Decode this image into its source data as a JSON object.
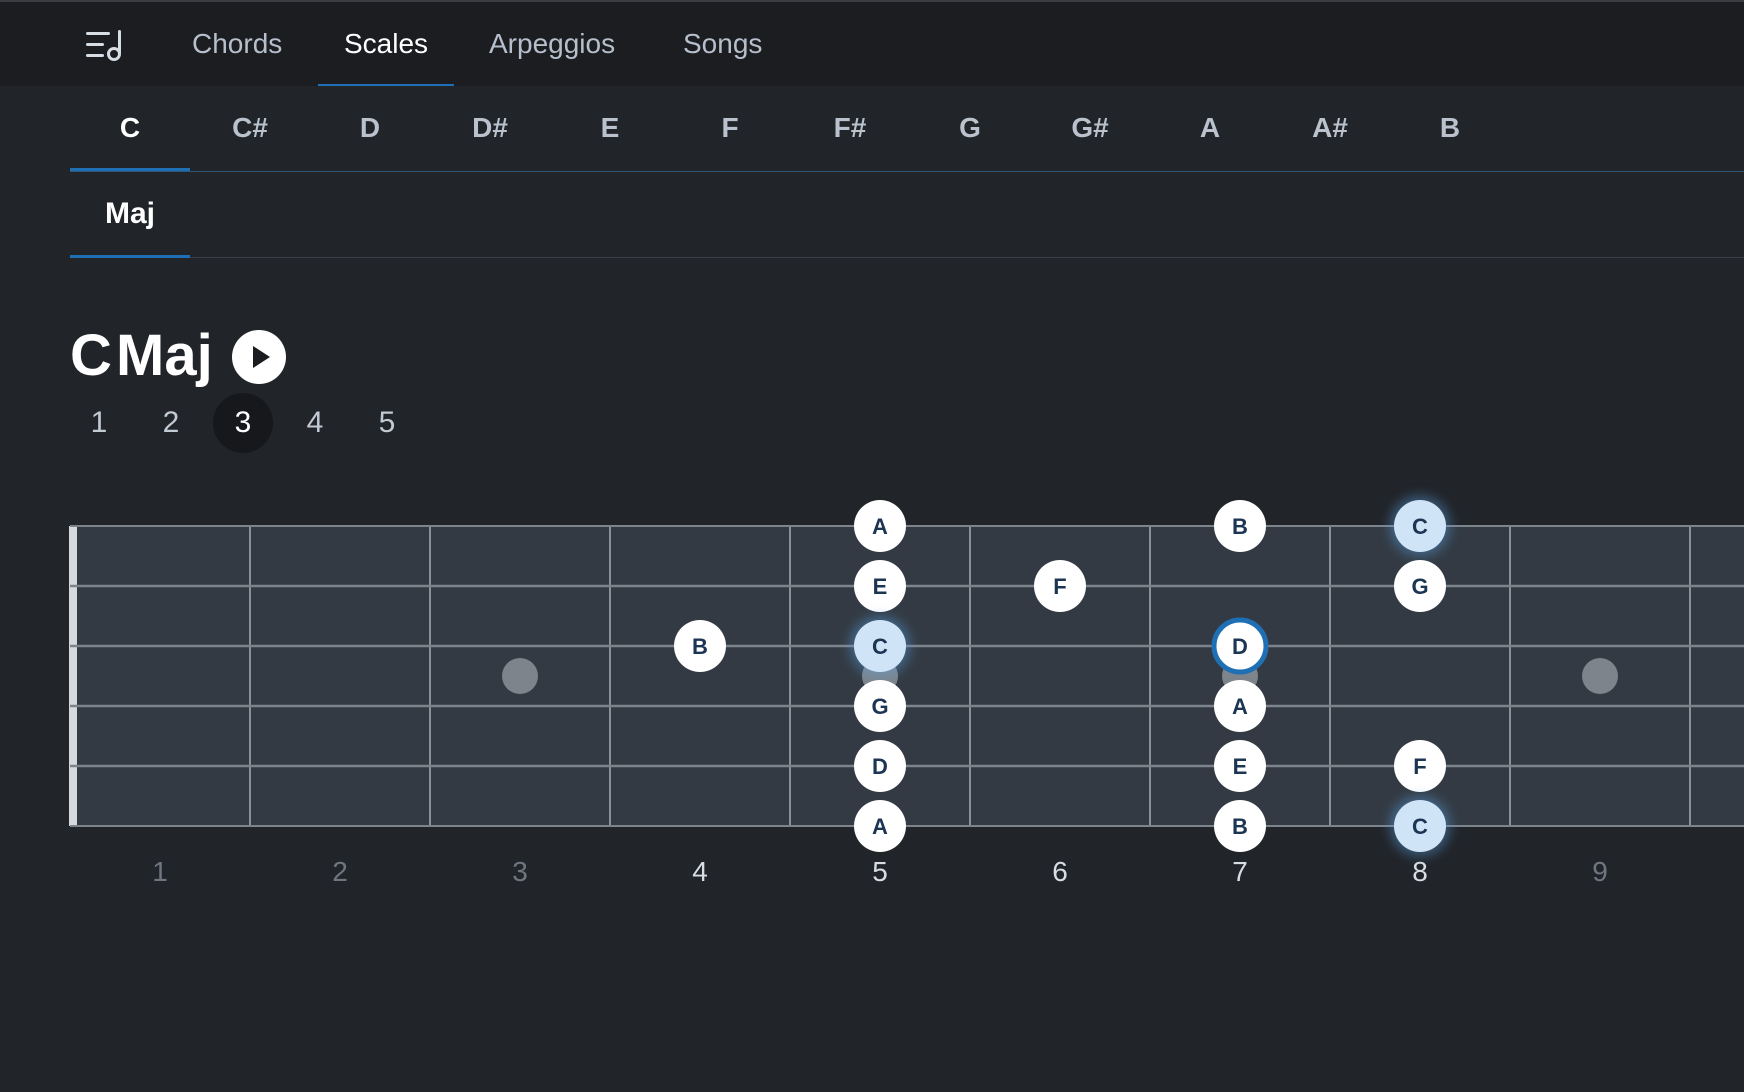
{
  "nav": {
    "tabs": [
      {
        "label": "Chords",
        "active": false
      },
      {
        "label": "Scales",
        "active": true
      },
      {
        "label": "Arpeggios",
        "active": false
      },
      {
        "label": "Songs",
        "active": false
      }
    ]
  },
  "keys": [
    "C",
    "C#",
    "D",
    "D#",
    "E",
    "F",
    "F#",
    "G",
    "G#",
    "A",
    "A#",
    "B"
  ],
  "selected_key": "C",
  "scale_types": [
    "Maj"
  ],
  "selected_type": "Maj",
  "title": {
    "root": "C",
    "quality": "Maj"
  },
  "positions": [
    "1",
    "2",
    "3",
    "4",
    "5"
  ],
  "selected_position": "3",
  "fretboard": {
    "fret_numbers": [
      "1",
      "2",
      "3",
      "4",
      "5",
      "6",
      "7",
      "8",
      "9"
    ],
    "dim_frets": [
      "1",
      "2",
      "3",
      "9"
    ],
    "inlay_frets": [
      3,
      5,
      7,
      9
    ],
    "notes": [
      {
        "string": 1,
        "fret": 5,
        "note": "A",
        "style": "normal"
      },
      {
        "string": 1,
        "fret": 7,
        "note": "B",
        "style": "normal"
      },
      {
        "string": 1,
        "fret": 8,
        "note": "C",
        "style": "root"
      },
      {
        "string": 2,
        "fret": 5,
        "note": "E",
        "style": "normal"
      },
      {
        "string": 2,
        "fret": 6,
        "note": "F",
        "style": "normal"
      },
      {
        "string": 2,
        "fret": 8,
        "note": "G",
        "style": "normal"
      },
      {
        "string": 3,
        "fret": 4,
        "note": "B",
        "style": "normal"
      },
      {
        "string": 3,
        "fret": 5,
        "note": "C",
        "style": "root"
      },
      {
        "string": 3,
        "fret": 7,
        "note": "D",
        "style": "selected"
      },
      {
        "string": 4,
        "fret": 5,
        "note": "G",
        "style": "normal"
      },
      {
        "string": 4,
        "fret": 7,
        "note": "A",
        "style": "normal"
      },
      {
        "string": 5,
        "fret": 5,
        "note": "D",
        "style": "normal"
      },
      {
        "string": 5,
        "fret": 7,
        "note": "E",
        "style": "normal"
      },
      {
        "string": 5,
        "fret": 8,
        "note": "F",
        "style": "normal"
      },
      {
        "string": 6,
        "fret": 5,
        "note": "A",
        "style": "normal"
      },
      {
        "string": 6,
        "fret": 7,
        "note": "B",
        "style": "normal"
      },
      {
        "string": 6,
        "fret": 8,
        "note": "C",
        "style": "root"
      }
    ]
  },
  "colors": {
    "accent": "#1f6fb5",
    "root_note": "#cfe4f7",
    "note": "#ffffff",
    "note_text": "#1c3552",
    "board": "#333a43",
    "inlay": "#7e848b"
  }
}
